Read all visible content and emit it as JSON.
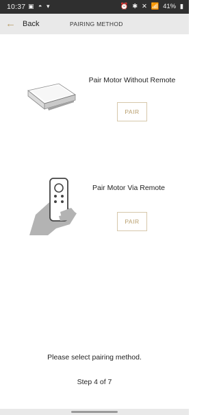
{
  "status_bar": {
    "time": "10:37",
    "left_icons": "▣ ◓ ▾",
    "right_icons": [
      "⏰",
      "✱",
      "✕",
      "📶",
      "41%",
      "▮"
    ]
  },
  "header": {
    "back_label": "Back",
    "title": "PAIRING METHOD",
    "accent_color": "#b79d6b"
  },
  "options": [
    {
      "title": "Pair Motor Without Remote",
      "button_label": "PAIR",
      "icon": "motor-box-icon"
    },
    {
      "title": "Pair Motor Via Remote",
      "button_label": "PAIR",
      "icon": "hand-remote-icon"
    }
  ],
  "instruction": "Please select pairing method.",
  "step": "Step 4 of 7"
}
